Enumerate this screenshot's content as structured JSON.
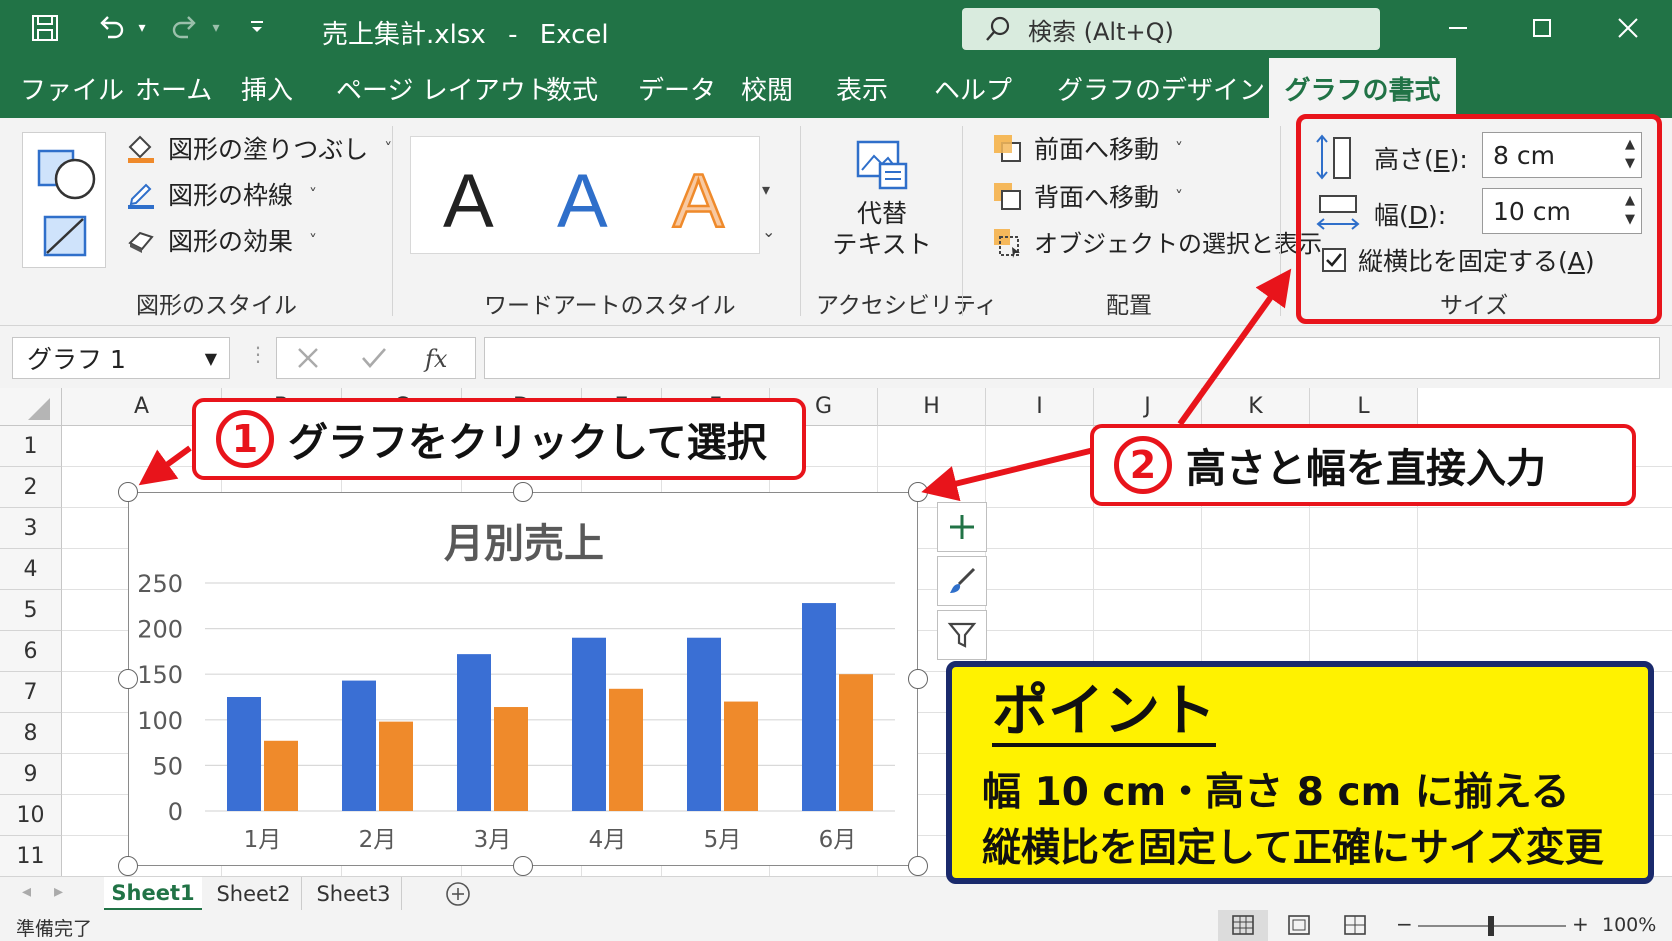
{
  "titlebar": {
    "filename": "売上集計.xlsx",
    "separator": "-",
    "app": "Excel",
    "search_placeholder": "検索 (Alt+Q)"
  },
  "menu": {
    "tabs": [
      "ファイル",
      "ホーム",
      "挿入",
      "ページ レイアウト",
      "数式",
      "データ",
      "校閲",
      "表示",
      "ヘルプ",
      "グラフのデザイン"
    ],
    "active_tab": "グラフの書式"
  },
  "ribbon": {
    "shape_styles": {
      "fill": "図形の塗りつぶし",
      "outline": "図形の枠線",
      "effects": "図形の効果",
      "group_label": "図形のスタイル"
    },
    "wordart": {
      "letter": "A",
      "group_label": "ワードアートのスタイル"
    },
    "accessibility": {
      "alt_text_line1": "代替",
      "alt_text_line2": "テキスト",
      "group_label": "アクセシビリティ"
    },
    "arrange": {
      "bring_forward": "前面へ移動",
      "send_backward": "背面へ移動",
      "selection_pane": "オブジェクトの選択と表示",
      "group_label": "配置"
    },
    "size": {
      "height_label_prefix": "高さ(",
      "height_label_key": "E",
      "height_label_suffix": "):",
      "height_value": "8 cm",
      "width_label_prefix": "幅(",
      "width_label_key": "D",
      "width_label_suffix": "):",
      "width_value": "10 cm",
      "lock_prefix": "縦横比を固定する(",
      "lock_key": "A",
      "lock_suffix": ")",
      "lock_checked": true,
      "group_label": "サイズ"
    }
  },
  "formula_bar": {
    "name_box": "グラフ 1",
    "fx": "fx",
    "value": ""
  },
  "grid": {
    "columns": [
      "A",
      "B",
      "C",
      "D",
      "E",
      "F",
      "G",
      "H",
      "I",
      "J",
      "K",
      "L"
    ],
    "rows": [
      "1",
      "2",
      "3",
      "4",
      "5",
      "6",
      "7",
      "8",
      "9",
      "10",
      "11"
    ]
  },
  "chart_data": {
    "type": "bar",
    "title": "月別売上",
    "categories": [
      "1月",
      "2月",
      "3月",
      "4月",
      "5月",
      "6月"
    ],
    "series": [
      {
        "values": [
          125,
          143,
          172,
          190,
          190,
          228
        ]
      },
      {
        "values": [
          77,
          98,
          114,
          134,
          120,
          150
        ]
      }
    ],
    "ylim": [
      0,
      250
    ],
    "yticks": [
      "0",
      "50",
      "100",
      "150",
      "200",
      "250"
    ],
    "grid": true,
    "colors": [
      "#3a6fd4",
      "#ef8a2b"
    ]
  },
  "sheets": {
    "tabs": [
      "Sheet1",
      "Sheet2",
      "Sheet3"
    ],
    "active": "Sheet1"
  },
  "status": {
    "ready": "準備完了",
    "zoom": "100%"
  },
  "annotations": {
    "callout1_number": "1",
    "callout1_text": "グラフをクリックして選択",
    "callout2_number": "2",
    "callout2_text": "高さと幅を直接入力",
    "point_title": "ポイント",
    "point_line1": "幅 10 cm・高さ 8 cm に揃える",
    "point_line2": "縦横比を固定して正確にサイズ変更",
    "accent_red": "#e8141b",
    "point_bg": "#fff200",
    "point_border": "#1a2a6c"
  },
  "colors": {
    "excel_green": "#217346"
  }
}
